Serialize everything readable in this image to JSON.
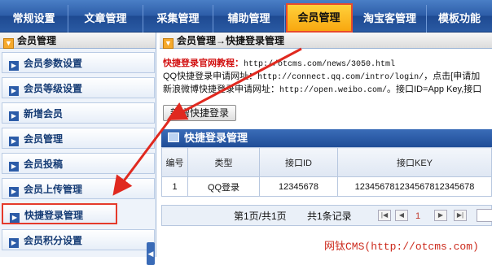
{
  "topnav": {
    "tabs": [
      {
        "label": "常规设置"
      },
      {
        "label": "文章管理"
      },
      {
        "label": "采集管理"
      },
      {
        "label": "辅助管理"
      },
      {
        "label": "会员管理",
        "active": true
      },
      {
        "label": "淘宝客管理"
      },
      {
        "label": "模板功能"
      }
    ]
  },
  "sidebar": {
    "title": "会员管理",
    "items": [
      {
        "label": "会员参数设置"
      },
      {
        "label": "会员等级设置"
      },
      {
        "label": "新增会员"
      },
      {
        "label": "会员管理"
      },
      {
        "label": "会员投稿"
      },
      {
        "label": "会员上传管理"
      },
      {
        "label": "快捷登录管理",
        "active": true
      },
      {
        "label": "会员积分设置"
      }
    ]
  },
  "main": {
    "breadcrumb": "会员管理→快捷登录管理",
    "info": {
      "line1_label": "快捷登录官网教程：",
      "line1_url": "http://otcms.com/news/3050.html",
      "line2_label": "QQ快捷登录申请网址：",
      "line2_url": "http://connect.qq.com/intro/login/",
      "line2_tail": "，点击[申请加",
      "line3_label": "新浪微博快捷登录申请网址：",
      "line3_url": "http://open.weibo.com/",
      "line3_tail": "。接口ID=App Key,接口"
    },
    "add_button": "新增快捷登录",
    "panel_title": "快捷登录管理",
    "table": {
      "headers": [
        "编号",
        "类型",
        "接口ID",
        "接口KEY"
      ],
      "rows": [
        [
          "1",
          "QQ登录",
          "12345678",
          "123456781234567812345678"
        ]
      ]
    },
    "pager": {
      "page_info": "第1页/共1页",
      "record_info": "共1条记录",
      "current_page": "1"
    }
  },
  "watermark": "网钛CMS(http://otcms.com)",
  "colors": {
    "nav_blue": "#2d5da8",
    "active_tab": "#f8a60e",
    "highlight_red": "#e53a2b"
  }
}
